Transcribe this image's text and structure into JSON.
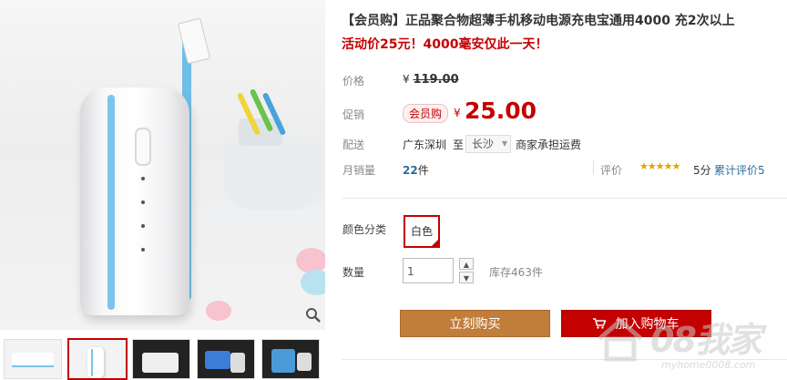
{
  "product": {
    "title": "【会员购】正品聚合物超薄手机移动电源充电宝通用4000 充2次以上",
    "subtitle": "活动价25元！4000毫安仅此一天！"
  },
  "price": {
    "label": "价格",
    "currency": "¥",
    "original": "119.00"
  },
  "promo": {
    "label": "促销",
    "badge": "会员购",
    "currency": "¥",
    "price": "25.00"
  },
  "shipping": {
    "label": "配送",
    "from": "广东深圳",
    "to_word": "至",
    "destination": "长沙",
    "freight": "商家承担运费"
  },
  "sales": {
    "label": "月销量",
    "count": "22",
    "unit": "件"
  },
  "rating": {
    "label": "评价",
    "stars": "★★★★★",
    "score": "5分",
    "reviews_link": "累计评价5"
  },
  "options": {
    "color_label": "颜色分类",
    "color_value": "白色"
  },
  "quantity": {
    "label": "数量",
    "value": "1",
    "stock": "库存463件"
  },
  "actions": {
    "buy_now": "立刻购买",
    "add_to_cart": "加入购物车"
  },
  "gallery": {
    "thumbnail_count": 5,
    "active_index": 1
  },
  "colors": {
    "accent_red": "#c40000",
    "buy_button": "#c17d3a",
    "link_blue": "#2d6d9c",
    "star": "#e5a300"
  },
  "watermark": {
    "brand": "08我家",
    "url": "myhome0008.com"
  }
}
